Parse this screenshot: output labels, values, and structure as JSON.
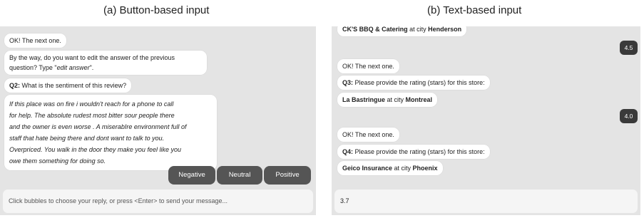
{
  "captions": {
    "a": "(a) Button-based input",
    "b": "(b) Text-based input"
  },
  "panel_a": {
    "messages": [
      "OK! The next one.",
      "By the way, do you want to edit the answer of the previous",
      "question? Type \"",
      "edit answer",
      "\".",
      "Q2:",
      " What is the sentiment of this review?"
    ],
    "review_lines": [
      "If this place was on fire i wouldn't reach for a phone to call",
      "for help. The absolute rudest most bitter sour people there",
      "and the owner is even worse . A miserabIre environment full of",
      "staff that hate being there and dont want to talk to you.",
      "Overpriced. You walk in the door they make you feel like you",
      "owe them something for doing so."
    ],
    "choices": [
      "Negative",
      "Neutral",
      "Positive"
    ],
    "input_placeholder": "Click bubbles to choose your reply, or press <Enter> to send your message..."
  },
  "panel_b": {
    "cut_store": "CK'S BBQ & Catering",
    "cut_city_label": " at city ",
    "cut_city": "Henderson",
    "rating_1": "4.5",
    "next_1": "OK! The next one.",
    "q3_label": "Q3:",
    "q3_text": " Please provide the rating (stars) for this store:",
    "store_3": "La Bastringue",
    "at_city": " at city ",
    "city_3": "Montreal",
    "rating_2": "4.0",
    "next_2": "OK! The next one.",
    "q4_label": "Q4:",
    "q4_text": " Please provide the rating (stars) for this store:",
    "store_4": "Geico Insurance",
    "city_4": "Phoenix",
    "input_value": "3.7"
  },
  "colors": {
    "panel_bg": "#e4e4e4",
    "button_bg": "#555555",
    "rating_pill_bg": "#3a3a3a"
  }
}
